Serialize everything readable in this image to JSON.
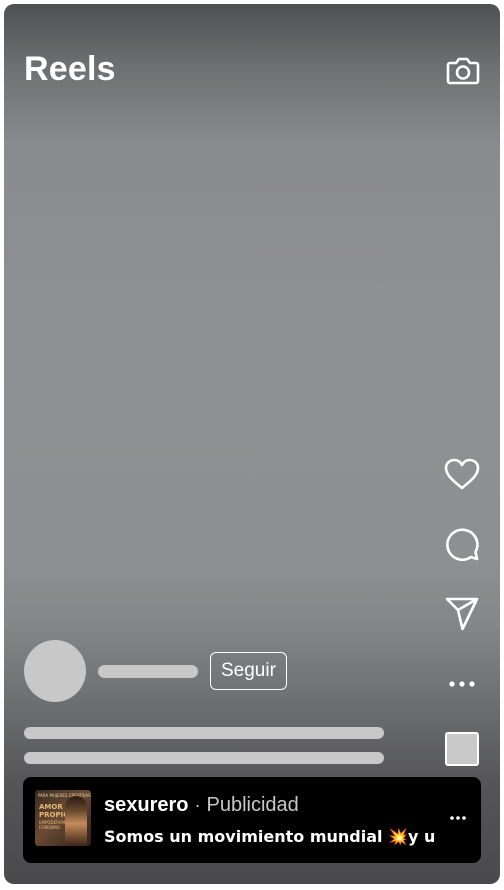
{
  "header": {
    "title": "Reels",
    "camera_icon": "camera-icon"
  },
  "actions": {
    "like_icon": "heart-icon",
    "comment_icon": "comment-icon",
    "share_icon": "send-icon",
    "more_icon": "more-horizontal-icon"
  },
  "author": {
    "follow_label": "Seguir"
  },
  "ad": {
    "account": "sexurero",
    "separator": "·",
    "label": "Publicidad",
    "caption": "Somos un movimiento mundial 💥y un…",
    "thumbnail_text_top": "PARA MUJERES CREATIVAS",
    "thumbnail_text_main": "AMOR PROPIO",
    "thumbnail_text_sub": "EMPODERAMIENTO FEMENINO"
  },
  "colors": {
    "overlay_text": "#ffffff",
    "skeleton": "#c8c8c8",
    "ad_background": "#000000",
    "ad_secondary_text": "#c8c8c8"
  }
}
